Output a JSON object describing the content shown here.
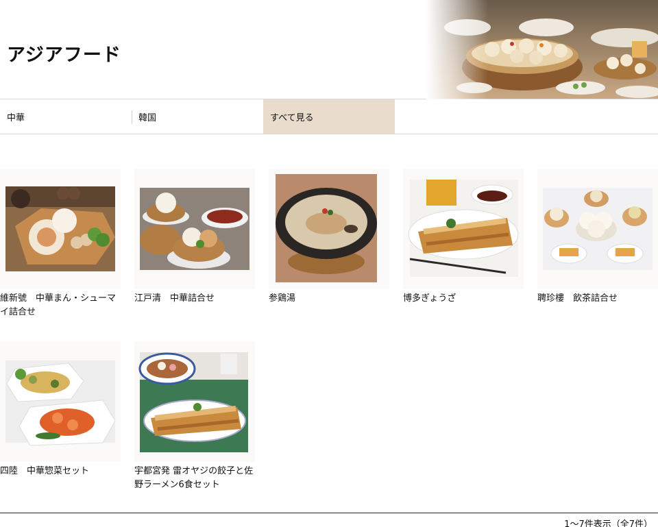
{
  "header": {
    "title": "アジアフード",
    "hero_image": "dim-sum-steamer-banner"
  },
  "tabs": [
    {
      "label": "中華",
      "active": false
    },
    {
      "label": "韓国",
      "active": false
    },
    {
      "label": "すべて見る",
      "active": true
    }
  ],
  "products": [
    {
      "title": "維新號　中華まん・シューマイ詰合せ",
      "image": "chinese-buns-shumai-image"
    },
    {
      "title": "江戸清　中華詰合せ",
      "image": "steamer-buns-assortment-image"
    },
    {
      "title": "参鶏湯",
      "image": "samgyetang-pot-image"
    },
    {
      "title": "博多ぎょうざ",
      "image": "fried-gyoza-plate-image"
    },
    {
      "title": "聘珍樓　飲茶詰合せ",
      "image": "dim-sum-assortment-image"
    },
    {
      "title": "四陸　中華惣菜セット",
      "image": "chinese-side-dishes-image"
    },
    {
      "title": "宇都宮発 雷オヤジの餃子と佐野ラーメン6食セット",
      "image": "gyoza-ramen-set-image"
    }
  ],
  "footer": {
    "count_text": "1〜7件表示（全7件）"
  },
  "colors": {
    "active_tab": "#e9dccd",
    "text": "#111111",
    "divider": "#d9d9d9"
  }
}
